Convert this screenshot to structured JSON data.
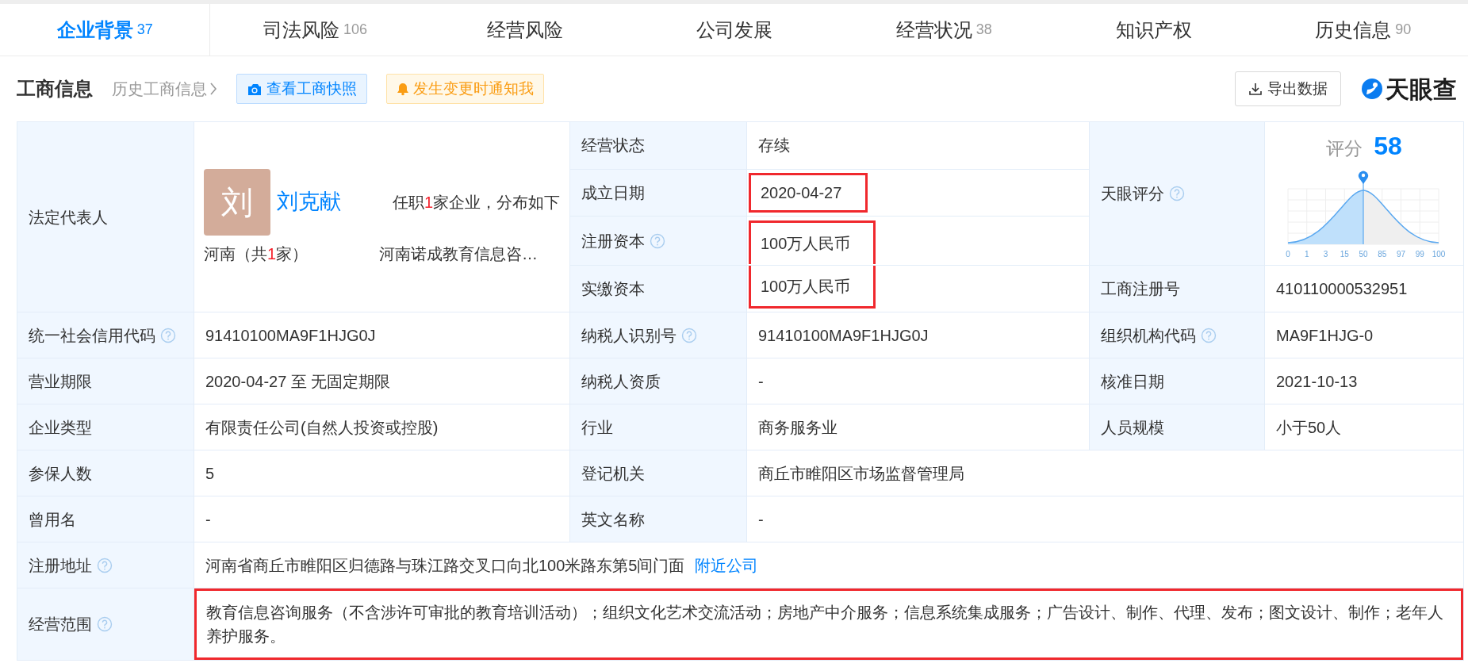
{
  "tabs": [
    {
      "label": "企业背景",
      "count": "37",
      "selected": true
    },
    {
      "label": "司法风险",
      "count": "106",
      "selected": false
    },
    {
      "label": "经营风险",
      "selected": false
    },
    {
      "label": "公司发展",
      "selected": false
    },
    {
      "label": "经营状况",
      "count": "38",
      "selected": false
    },
    {
      "label": "知识产权",
      "selected": false
    },
    {
      "label": "历史信息",
      "count": "90",
      "selected": false
    }
  ],
  "section": {
    "title": "工商信息",
    "history_link": "历史工商信息",
    "snapshot_button": "查看工商快照",
    "notify_button": "发生变更时通知我",
    "export_button": "导出数据",
    "logo_text": "天眼查"
  },
  "legal_rep": {
    "label": "法定代表人",
    "avatar_char": "刘",
    "name": "刘克献",
    "positions": [
      "任职",
      "1",
      "家企业，分布如下"
    ],
    "region": [
      "河南（共",
      "1",
      "家）"
    ],
    "company": "河南诺成教育信息咨…"
  },
  "status_fields": [
    {
      "label": "经营状态",
      "value": "存续",
      "help": false,
      "highlighted": false
    },
    {
      "label": "成立日期",
      "value": "2020-04-27",
      "help": false,
      "highlighted": true
    },
    {
      "label": "注册资本",
      "value": "100万人民币",
      "help": true,
      "highlighted": true,
      "box_continues": true
    },
    {
      "label": "实缴资本",
      "value": "100万人民币",
      "help": false,
      "highlighted": true
    }
  ],
  "score": {
    "label": "天眼评分",
    "help": true,
    "caption": "评分",
    "value": "58",
    "axis_labels": [
      "0",
      "1",
      "3",
      "15",
      "50",
      "85",
      "97",
      "99",
      "100"
    ]
  },
  "reg_number": {
    "label": "工商注册号",
    "value": "410110000532951",
    "help": false
  },
  "rows": [
    {
      "cells": [
        {
          "label": "统一社会信用代码",
          "help": true,
          "value": "91410100MA9F1HJG0J"
        },
        {
          "label": "纳税人识别号",
          "help": true,
          "value": "91410100MA9F1HJG0J"
        },
        {
          "label": "组织机构代码",
          "help": true,
          "value": "MA9F1HJG-0"
        }
      ]
    },
    {
      "cells": [
        {
          "label": "营业期限",
          "help": false,
          "value": "2020-04-27 至 无固定期限"
        },
        {
          "label": "纳税人资质",
          "help": false,
          "value": "-"
        },
        {
          "label": "核准日期",
          "help": false,
          "value": "2021-10-13"
        }
      ]
    },
    {
      "cells": [
        {
          "label": "企业类型",
          "help": false,
          "value": "有限责任公司(自然人投资或控股)"
        },
        {
          "label": "行业",
          "help": false,
          "value": "商务服务业"
        },
        {
          "label": "人员规模",
          "help": false,
          "value": "小于50人"
        }
      ]
    },
    {
      "cells": [
        {
          "label": "参保人数",
          "help": false,
          "value": "5"
        },
        {
          "label": "登记机关",
          "help": false,
          "value": "商丘市睢阳区市场监督管理局"
        }
      ]
    },
    {
      "cells": [
        {
          "label": "曾用名",
          "help": false,
          "value": "-"
        },
        {
          "label": "英文名称",
          "help": false,
          "value": "-"
        }
      ]
    },
    {
      "cells": [
        {
          "label": "注册地址",
          "help": true,
          "value": "河南省商丘市睢阳区归德路与珠江路交叉口向北100米路东第5间门面",
          "link": "附近公司"
        }
      ]
    },
    {
      "cells": [
        {
          "label": "经营范围",
          "help": true,
          "value": "教育信息咨询服务（不含涉许可审批的教育培训活动）；组织文化艺术交流活动；房地产中介服务；信息系统集成服务；广告设计、制作、代理、发布；图文设计、制作；老年人养护服务。",
          "highlighted": true
        }
      ]
    }
  ]
}
